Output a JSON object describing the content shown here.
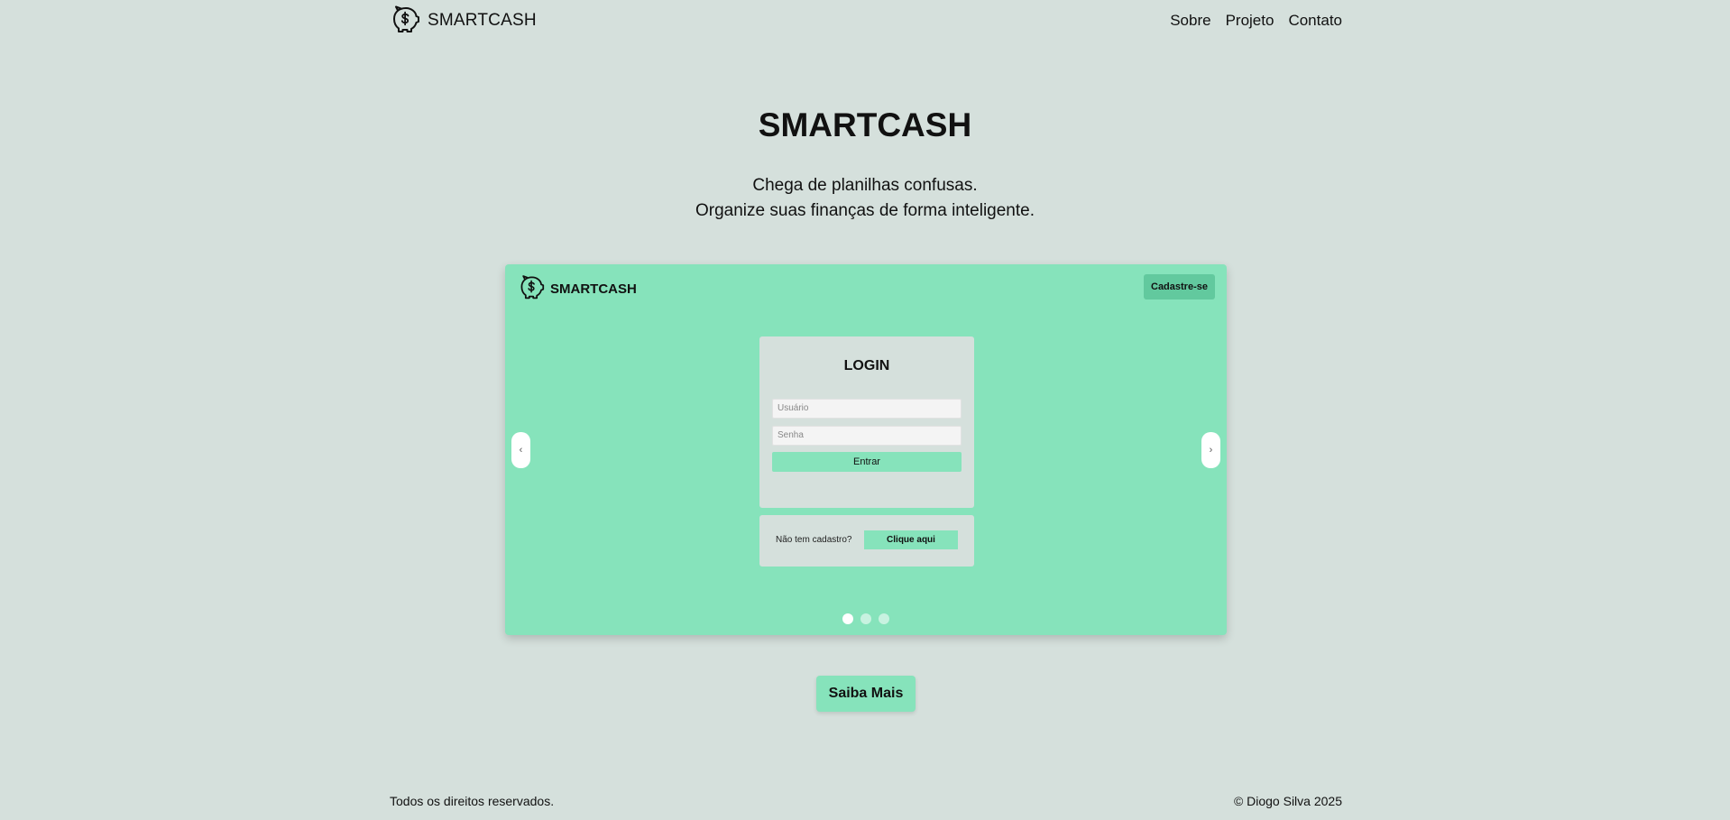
{
  "navbar": {
    "brand": "SMARTCASH",
    "brand_icon": "piggy-bank-icon",
    "links": [
      "Sobre",
      "Projeto",
      "Contato"
    ]
  },
  "hero": {
    "title": "SMARTCASH",
    "subtitle_line1": "Chega de planilhas confusas.",
    "subtitle_line2": "Organize suas finanças de forma inteligente."
  },
  "carousel": {
    "slide": {
      "brand": "SMARTCASH",
      "signup_label": "Cadastre-se",
      "login_title": "LOGIN",
      "username_placeholder": "Usuário",
      "password_placeholder": "Senha",
      "submit_label": "Entrar",
      "no_account_text": "Não tem cadastro?",
      "click_here_label": "Clique aqui"
    },
    "prev_icon": "‹",
    "next_icon": "›",
    "dots_count": 3,
    "active_dot": 1
  },
  "cta": {
    "label": "Saiba Mais"
  },
  "footer": {
    "left": "Todos os direitos reservados.",
    "right": "© Diogo Silva 2025"
  },
  "colors": {
    "background": "#d5e0dc",
    "accent": "#86e3bb",
    "accent_dark": "#62c99e"
  }
}
